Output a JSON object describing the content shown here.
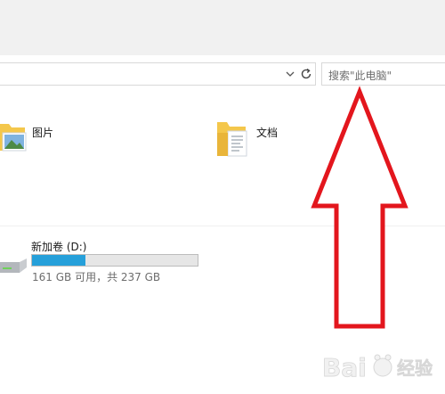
{
  "toolbar": {
    "refresh_icon": "refresh-icon",
    "dropdown_icon": "chevron-down-icon"
  },
  "search": {
    "placeholder": "搜索\"此电脑\""
  },
  "folders": [
    {
      "label": "图片",
      "icon": "pictures-folder-icon"
    },
    {
      "label": "文档",
      "icon": "documents-folder-icon"
    }
  ],
  "drive": {
    "label": "新加卷 (D:)",
    "usage_text": "161 GB 可用，共 237 GB",
    "used_fraction": 0.32,
    "bar_color": "#26a0da",
    "icon": "hard-drive-icon"
  },
  "annotation": {
    "arrow_color": "#e3161d",
    "shape": "up-arrow"
  },
  "watermark": {
    "text": "Bai 经验",
    "icon": "paw-logo"
  }
}
